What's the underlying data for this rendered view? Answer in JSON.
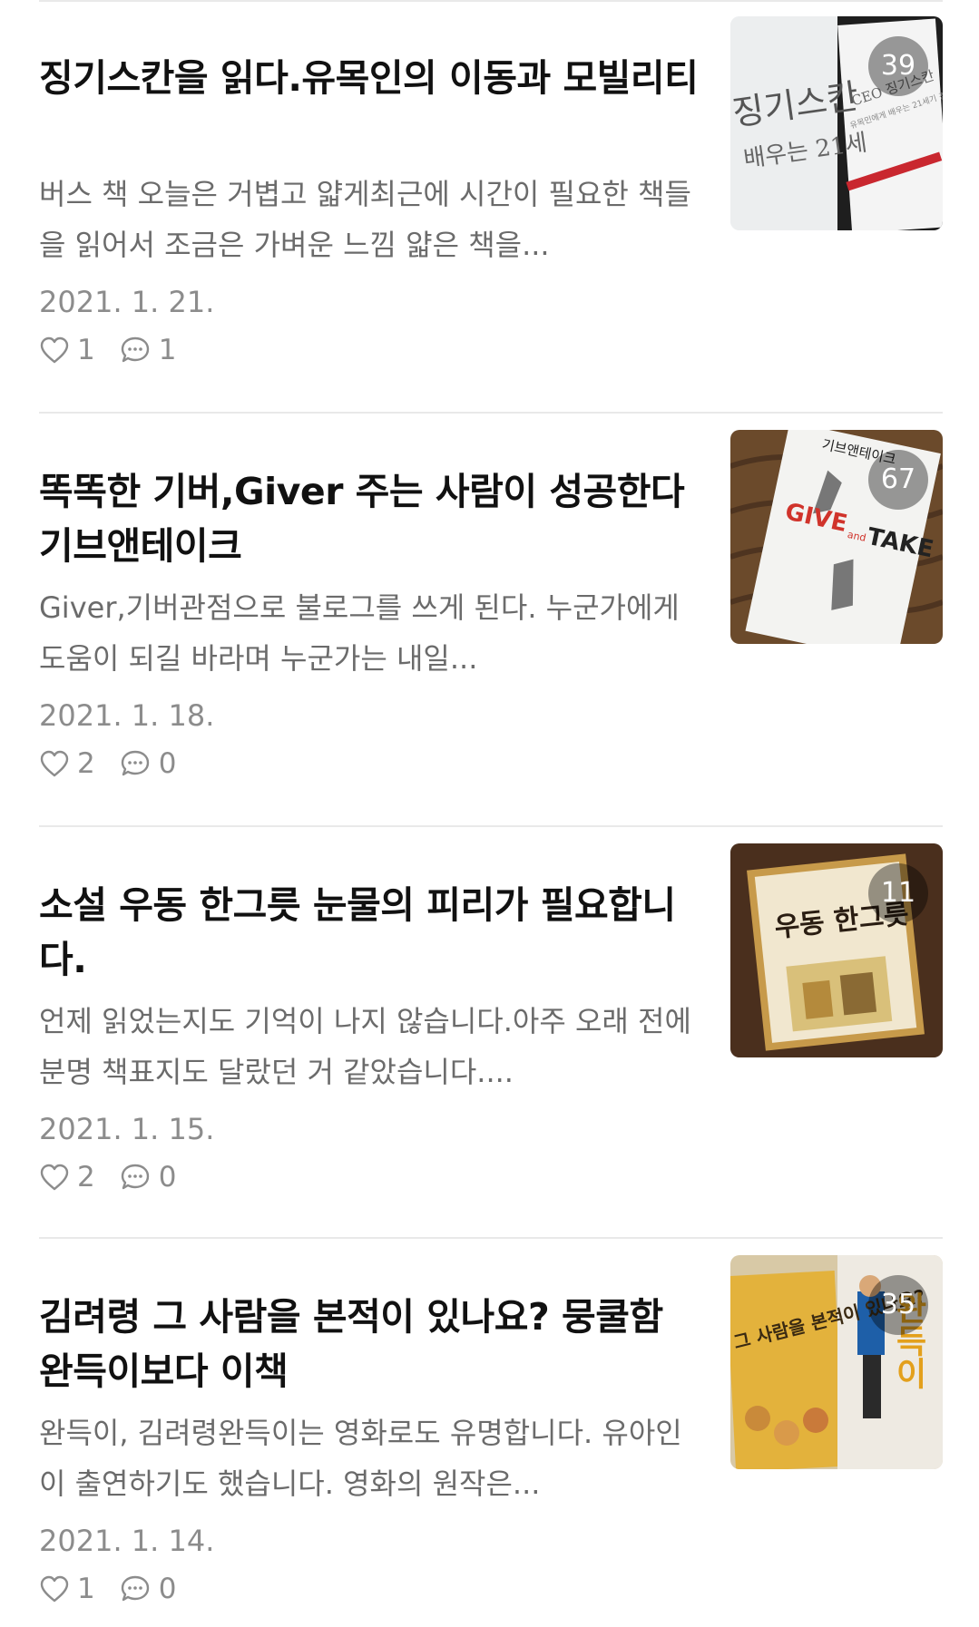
{
  "posts": [
    {
      "title": "징기스칸을 읽다.유목인의 이동과 모빌리티",
      "excerpt": "버스 책 오늘은 거볍고 얇게최근에 시간이 필요한 책들을 읽어서 조금은 가벼운 느낌 얇은 책을...",
      "date": "2021. 1. 21.",
      "likes": "1",
      "comments": "1",
      "photo_count": "39",
      "thumb_text": {
        "left": "징기스칸",
        "left_sub": "배우는 21세",
        "right": "CEO 징기스칸",
        "right_sub": "유목민에게 배우는 21세기 경"
      }
    },
    {
      "title": "똑똑한 기버,Giver 주는 사람이 성공한다 기브앤테이크",
      "excerpt": "Giver,기버관점으로 불로그를 쓰게 된다. 누군가에게 도움이 되길 바라며 누군가는 내일...",
      "date": "2021. 1. 18.",
      "likes": "2",
      "comments": "0",
      "photo_count": "67",
      "thumb_text": {
        "top": "기브앤테이크",
        "give": "GIVE",
        "and": "and",
        "take": "TAKE"
      }
    },
    {
      "title": "소설 우동 한그릇 눈물의 피리가 필요합니다.",
      "excerpt": "언제 읽었는지도 기억이 나지 않습니다.아주 오래 전에 분명 책표지도 달랐던 거 같았습니다....",
      "date": "2021. 1. 15.",
      "likes": "2",
      "comments": "0",
      "photo_count": "11",
      "thumb_text": {
        "cover": "우동 한그릇"
      }
    },
    {
      "title": "김려령 그 사람을 본적이 있나요? 뭉쿨함 완득이보다 이책",
      "excerpt": "완득이, 김려령완득이는 영화로도 유명합니다. 유아인이 출연하기도 했습니다. 영화의 원작은...",
      "date": "2021. 1. 14.",
      "likes": "1",
      "comments": "0",
      "photo_count": "35",
      "thumb_text": {
        "left": "그 사람을 본적이 있나요?",
        "right": "완득이"
      }
    }
  ],
  "icons": {
    "like": "heart-outline-icon",
    "comment": "speech-bubble-dots-icon"
  },
  "colors": {
    "title": "#111111",
    "excerpt": "#6b6b6b",
    "meta": "#8c8c8c",
    "divider": "#e9e9e9",
    "badge_bg": "rgba(0,0,0,0.38)"
  }
}
